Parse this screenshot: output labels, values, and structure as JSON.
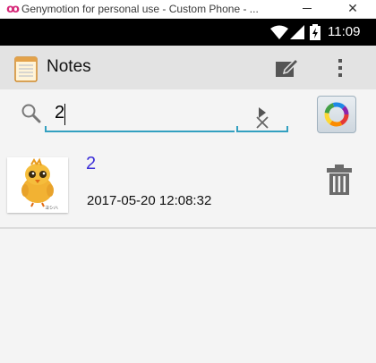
{
  "window": {
    "title": "Genymotion for personal use - Custom Phone - ...",
    "logo_glyph": "oo",
    "close_glyph": "✕"
  },
  "statusbar": {
    "time": "11:09",
    "icons": [
      "wifi-icon",
      "signal-icon",
      "battery-charging-icon"
    ]
  },
  "actionbar": {
    "title": "Notes",
    "icons": [
      "notepad-icon",
      "edit-icon",
      "overflow-menu-icon"
    ]
  },
  "search": {
    "value": "2",
    "clear_glyph": "×",
    "icons": [
      "search-icon",
      "clear-icon",
      "go-arrow-icon",
      "color-wheel-icon"
    ],
    "accent_color": "#33a0c0"
  },
  "notes": [
    {
      "title": "2",
      "date": "2017-05-20 12:08:32",
      "thumbnail_icon": "chick-image",
      "title_color": "#3d30d8"
    }
  ]
}
